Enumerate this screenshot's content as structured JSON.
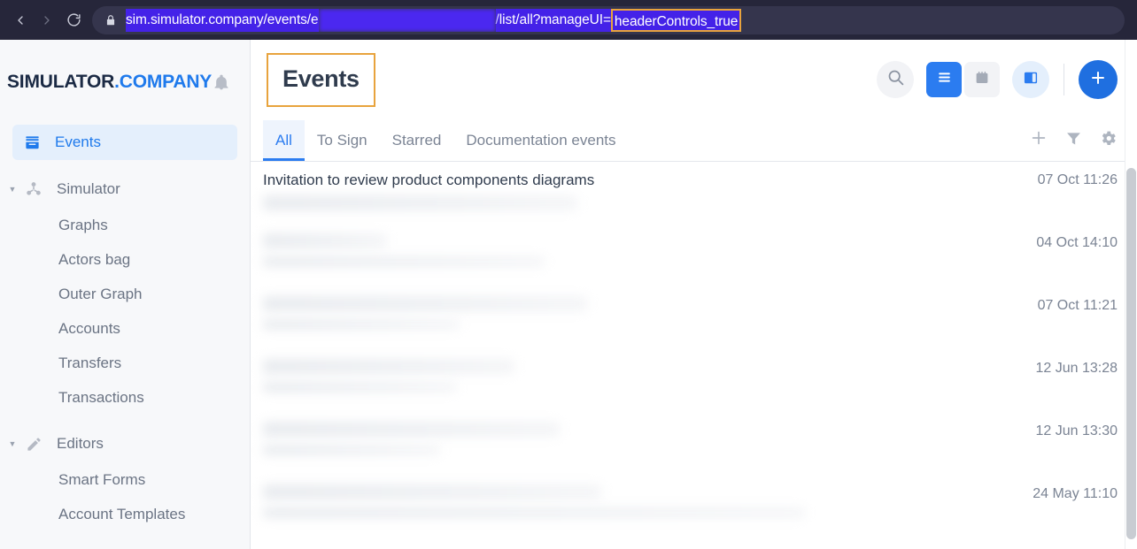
{
  "browser": {
    "back_label": "Back",
    "forward_label": "Forward",
    "reload_label": "Reload",
    "lock_label": "Site information",
    "url_prefix": "sim.simulator.company/events/e",
    "url_suffix": "/list/all?manageUI=",
    "url_highlight": "headerControls_true",
    "highlight_color": "#e8a33d",
    "selection_color": "#4422e8"
  },
  "sidebar": {
    "brand": {
      "name": "SIMULATOR",
      "suffix": ".COMPANY"
    },
    "bell_label": "Notifications",
    "items": [
      {
        "label": "Events",
        "icon": "inbox-icon",
        "active": true,
        "type": "item"
      },
      {
        "label": "Simulator",
        "icon": "network-icon",
        "active": false,
        "type": "group"
      },
      {
        "label": "Graphs",
        "type": "child"
      },
      {
        "label": "Actors bag",
        "type": "child"
      },
      {
        "label": "Outer Graph",
        "type": "child"
      },
      {
        "label": "Accounts",
        "type": "child"
      },
      {
        "label": "Transfers",
        "type": "child"
      },
      {
        "label": "Transactions",
        "type": "child"
      },
      {
        "label": "Editors",
        "icon": "pencil-icon",
        "active": false,
        "type": "group"
      },
      {
        "label": "Smart Forms",
        "type": "child"
      },
      {
        "label": "Account Templates",
        "type": "child"
      }
    ]
  },
  "header": {
    "title": "Events",
    "title_highlighted": true,
    "actions": {
      "search_label": "Search",
      "list_view_label": "List view",
      "calendar_view_label": "Calendar view",
      "panel_toggle_label": "Toggle details panel",
      "add_label": "Create new event"
    }
  },
  "tabs": [
    {
      "label": "All",
      "active": true
    },
    {
      "label": "To Sign",
      "active": false
    },
    {
      "label": "Starred",
      "active": false
    },
    {
      "label": "Documentation events",
      "active": false
    }
  ],
  "tab_tools": {
    "add_label": "Add",
    "filter_label": "Filter",
    "settings_label": "Settings"
  },
  "events": [
    {
      "title": "Invitation to review product components diagrams",
      "date": "07 Oct 11:26",
      "redacted": false
    },
    {
      "title": "",
      "date": "04 Oct 14:10",
      "redacted": true
    },
    {
      "title": "",
      "date": "07 Oct 11:21",
      "redacted": true
    },
    {
      "title": "",
      "date": "12 Jun 13:28",
      "redacted": true
    },
    {
      "title": "",
      "date": "12 Jun 13:30",
      "redacted": true
    },
    {
      "title": "",
      "date": "24 May 11:10",
      "redacted": true
    }
  ],
  "colors": {
    "accent": "#2b7cf0",
    "brand_dark": "#1b2a44",
    "highlight": "#e8a33d",
    "sidebar_bg": "#f7f8fa"
  }
}
